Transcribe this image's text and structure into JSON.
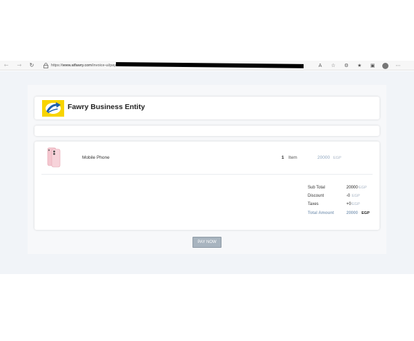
{
  "browser": {
    "url_scheme": "https://",
    "url_host": "www.atfawry.com",
    "url_path": "/invoice-ui/pay/b01744c8"
  },
  "header": {
    "brand_title": "Fawry Business Entity"
  },
  "invoice": {
    "items": [
      {
        "name": "Mobile Phone",
        "quantity": "1",
        "unit": "Item",
        "amount": "20000",
        "currency": "EGP"
      }
    ],
    "totals": {
      "sub_total_label": "Sub Total",
      "sub_total_value": "20000",
      "discount_label": "Discount",
      "discount_value": "-0",
      "taxes_label": "Taxes",
      "taxes_value": "+0",
      "total_label": "Total Amount",
      "total_value": "20000",
      "currency": "EGP"
    }
  },
  "actions": {
    "pay_label": "PAY NOW"
  },
  "colors": {
    "logo_yellow": "#f8d400",
    "logo_blue": "#1b5fad",
    "accent_muted": "#8fa6bf",
    "button_gray": "#a8b4bf"
  }
}
